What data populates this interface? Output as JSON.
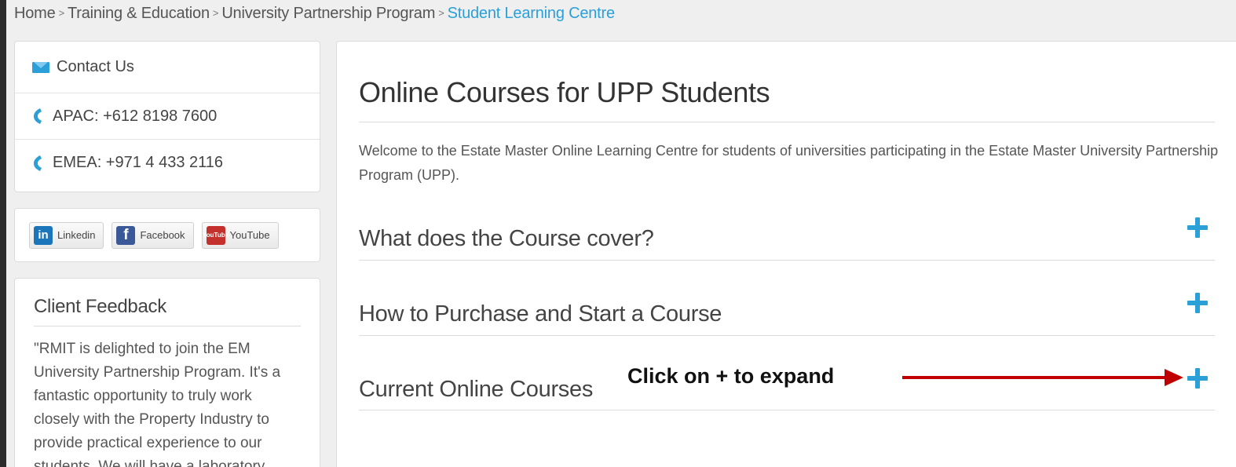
{
  "breadcrumb": {
    "items": [
      "Home",
      "Training & Education",
      "University Partnership Program"
    ],
    "current": "Student Learning Centre",
    "separator": ">"
  },
  "contact": {
    "title": "Contact Us",
    "apac_label": "APAC",
    "apac_number": ": +612 8198 7600",
    "emea_label": "EMEA",
    "emea_number": ": +971 4 433 2116"
  },
  "social": {
    "linkedin": "Linkedin",
    "facebook": "Facebook",
    "youtube": "YouTube",
    "linkedin_icon": "in",
    "facebook_icon": "f",
    "youtube_icon_top": "You",
    "youtube_icon_bottom": "Tube"
  },
  "feedback": {
    "title": "Client Feedback",
    "quote": "\"RMIT is delighted to join the EM University Partnership Program.  It's a fantastic opportunity to truly work closely with the Property Industry to provide practical experience to our students.  We will have a laboratory"
  },
  "main": {
    "title": "Online Courses for UPP Students",
    "intro": "Welcome to the Estate Master Online Learning Centre for students of universities participating in the Estate Master University Partnership Program (UPP).",
    "sections": [
      "What does the Course cover?",
      "How to Purchase and Start a Course",
      "Current Online Courses"
    ]
  },
  "annotation": {
    "text": "Click on  + to expand"
  },
  "colors": {
    "accent": "#2a9fd8",
    "arrow": "#c00000"
  }
}
